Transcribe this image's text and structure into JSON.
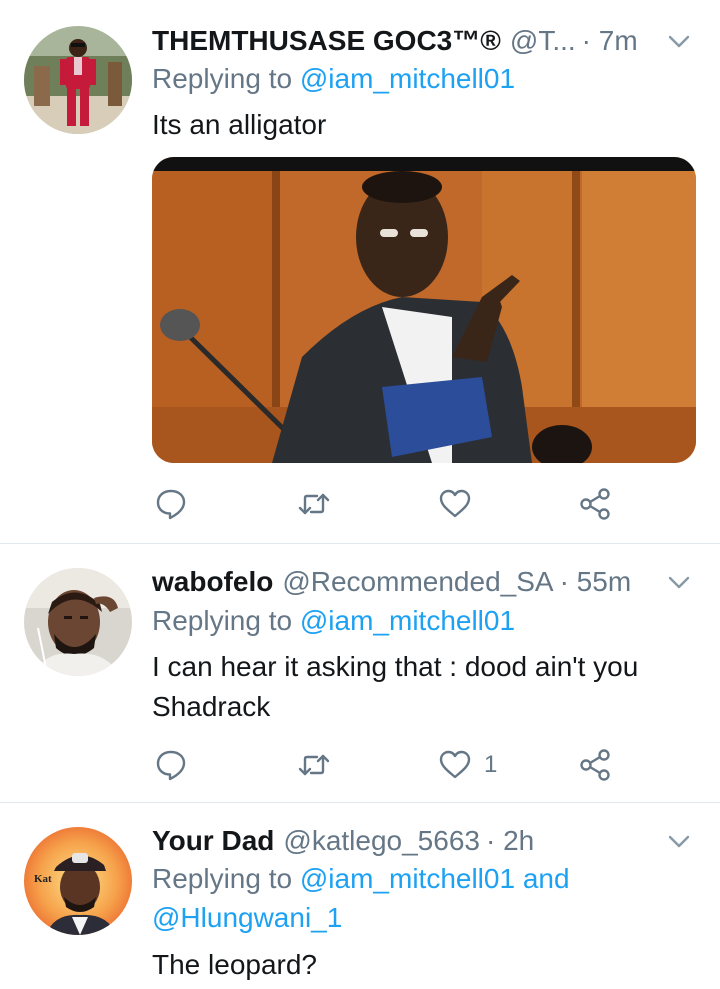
{
  "tweets": [
    {
      "name": "THEMTHUSASE GOC3™®",
      "handle": "@T...",
      "time": "· 7m",
      "replying_prefix": "Replying to ",
      "replying_to": "@iam_mitchell01",
      "text": "Its an alligator",
      "like_count": ""
    },
    {
      "name": "wabofelo",
      "handle": "@Recommended_SA",
      "time": "· 55m",
      "replying_prefix": "Replying to ",
      "replying_to": "@iam_mitchell01",
      "text": "I can hear it asking that : dood ain't you Shadrack",
      "like_count": "1"
    },
    {
      "name": "Your Dad",
      "handle": "@katlego_5663",
      "time": "· 2h",
      "replying_prefix": "Replying to ",
      "replying_to": "@iam_mitchell01 and",
      "replying_to_2": "@Hlungwani_1",
      "text": "The leopard?",
      "avatar_badge": "Kat"
    }
  ],
  "icons": {
    "reply": "reply-icon",
    "retweet": "retweet-icon",
    "like": "heart-icon",
    "share": "share-icon",
    "more": "chevron-down-icon"
  },
  "colors": {
    "link": "#1da1f2",
    "secondary": "#657786",
    "text": "#14171a",
    "divider": "#e1e8ed"
  }
}
